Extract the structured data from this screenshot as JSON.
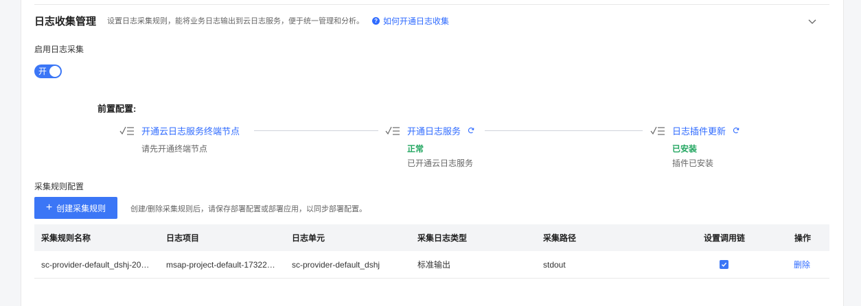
{
  "section": {
    "title": "日志收集管理",
    "subtitle": "设置日志采集规则，能将业务日志输出到云日志服务，便于统一管理和分析。",
    "help_link": "如何开通日志收集"
  },
  "enable": {
    "label": "启用日志采集",
    "toggle_text": "开",
    "on": true
  },
  "prereq": {
    "title": "前置配置:",
    "steps": [
      {
        "title": "开通云日志服务终端节点",
        "status": "",
        "desc": "请先开通终端节点"
      },
      {
        "title": "开通日志服务",
        "status": "正常",
        "desc": "已开通云日志服务"
      },
      {
        "title": "日志插件更新",
        "status": "已安装",
        "desc": "插件已安装"
      }
    ]
  },
  "rules": {
    "label": "采集规则配置",
    "create_button": "创建采集规则",
    "hint": "创建/删除采集规则后，请保存部署配置或部署应用，以同步部署配置。"
  },
  "table": {
    "columns": [
      "采集规则名称",
      "日志项目",
      "日志单元",
      "采集日志类型",
      "采集路径",
      "设置调用链",
      "操作"
    ],
    "rows": [
      {
        "name": "sc-provider-default_dshj-20…",
        "project": "msap-project-default-17322…",
        "unit": "sc-provider-default_dshj",
        "type": "标准输出",
        "path": "stdout",
        "trace": true,
        "action": "删除"
      }
    ]
  },
  "colors": {
    "accent": "#3b76f6",
    "link": "#2f6bff",
    "success": "#22a660"
  }
}
